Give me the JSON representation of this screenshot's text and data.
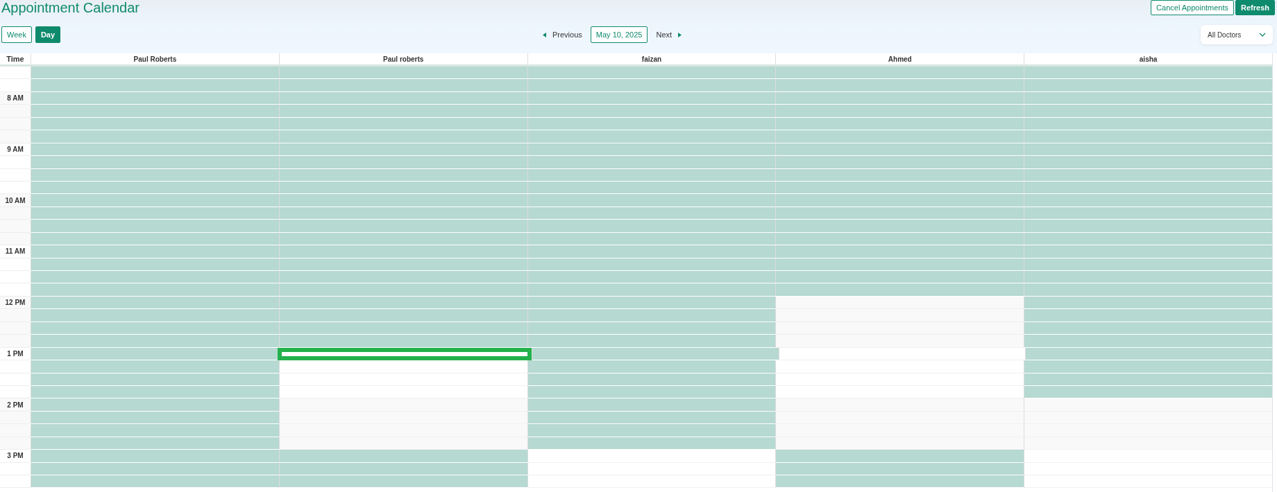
{
  "title": "Appointment Calendar",
  "actions": [
    {
      "label": "Cancel Appointments",
      "kind": "outline"
    },
    {
      "label": "Refresh",
      "kind": "solid"
    }
  ],
  "views": [
    {
      "label": "Week",
      "selected": false
    },
    {
      "label": "Day",
      "selected": true
    }
  ],
  "nav": {
    "previous": "Previous",
    "date": "May 10, 2025",
    "next": "Next"
  },
  "doctor_filter": {
    "value": "All Doctors"
  },
  "time_header": "Time",
  "doctors": [
    "Paul Roberts",
    "Paul roberts",
    "faizan",
    "Ahmed",
    "aisha"
  ],
  "rows": [
    {
      "time": "",
      "cells": [
        {
          "booked": true,
          "selected": false
        },
        {
          "booked": true,
          "selected": false
        },
        {
          "booked": true,
          "selected": false
        },
        {
          "booked": true,
          "selected": false
        },
        {
          "booked": true,
          "selected": false
        }
      ]
    },
    {
      "time": "",
      "cells": [
        {
          "booked": true,
          "selected": false
        },
        {
          "booked": true,
          "selected": false
        },
        {
          "booked": true,
          "selected": false
        },
        {
          "booked": true,
          "selected": false
        },
        {
          "booked": true,
          "selected": false
        }
      ]
    },
    {
      "time": "8 AM",
      "cells": [
        {
          "booked": true,
          "selected": false
        },
        {
          "booked": true,
          "selected": false
        },
        {
          "booked": true,
          "selected": false
        },
        {
          "booked": true,
          "selected": false
        },
        {
          "booked": true,
          "selected": false
        }
      ]
    },
    {
      "time": "",
      "cells": [
        {
          "booked": true,
          "selected": false
        },
        {
          "booked": true,
          "selected": false
        },
        {
          "booked": true,
          "selected": false
        },
        {
          "booked": true,
          "selected": false
        },
        {
          "booked": true,
          "selected": false
        }
      ]
    },
    {
      "time": "",
      "cells": [
        {
          "booked": true,
          "selected": false
        },
        {
          "booked": true,
          "selected": false
        },
        {
          "booked": true,
          "selected": false
        },
        {
          "booked": true,
          "selected": false
        },
        {
          "booked": true,
          "selected": false
        }
      ]
    },
    {
      "time": "",
      "cells": [
        {
          "booked": true,
          "selected": false
        },
        {
          "booked": true,
          "selected": false
        },
        {
          "booked": true,
          "selected": false
        },
        {
          "booked": true,
          "selected": false
        },
        {
          "booked": true,
          "selected": false
        }
      ]
    },
    {
      "time": "9 AM",
      "cells": [
        {
          "booked": true,
          "selected": false
        },
        {
          "booked": true,
          "selected": false
        },
        {
          "booked": true,
          "selected": false
        },
        {
          "booked": true,
          "selected": false
        },
        {
          "booked": true,
          "selected": false
        }
      ]
    },
    {
      "time": "",
      "cells": [
        {
          "booked": true,
          "selected": false
        },
        {
          "booked": true,
          "selected": false
        },
        {
          "booked": true,
          "selected": false
        },
        {
          "booked": true,
          "selected": false
        },
        {
          "booked": true,
          "selected": false
        }
      ]
    },
    {
      "time": "",
      "cells": [
        {
          "booked": true,
          "selected": false
        },
        {
          "booked": true,
          "selected": false
        },
        {
          "booked": true,
          "selected": false
        },
        {
          "booked": true,
          "selected": false
        },
        {
          "booked": true,
          "selected": false
        }
      ]
    },
    {
      "time": "",
      "cells": [
        {
          "booked": true,
          "selected": false
        },
        {
          "booked": true,
          "selected": false
        },
        {
          "booked": true,
          "selected": false
        },
        {
          "booked": true,
          "selected": false
        },
        {
          "booked": true,
          "selected": false
        }
      ]
    },
    {
      "time": "10 AM",
      "cells": [
        {
          "booked": true,
          "selected": false
        },
        {
          "booked": true,
          "selected": false
        },
        {
          "booked": true,
          "selected": false
        },
        {
          "booked": true,
          "selected": false
        },
        {
          "booked": true,
          "selected": false
        }
      ]
    },
    {
      "time": "",
      "cells": [
        {
          "booked": true,
          "selected": false
        },
        {
          "booked": true,
          "selected": false
        },
        {
          "booked": true,
          "selected": false
        },
        {
          "booked": true,
          "selected": false
        },
        {
          "booked": true,
          "selected": false
        }
      ]
    },
    {
      "time": "",
      "cells": [
        {
          "booked": true,
          "selected": false
        },
        {
          "booked": true,
          "selected": false
        },
        {
          "booked": true,
          "selected": false
        },
        {
          "booked": true,
          "selected": false
        },
        {
          "booked": true,
          "selected": false
        }
      ]
    },
    {
      "time": "",
      "cells": [
        {
          "booked": true,
          "selected": false
        },
        {
          "booked": true,
          "selected": false
        },
        {
          "booked": true,
          "selected": false
        },
        {
          "booked": true,
          "selected": false
        },
        {
          "booked": true,
          "selected": false
        }
      ]
    },
    {
      "time": "11 AM",
      "cells": [
        {
          "booked": true,
          "selected": false
        },
        {
          "booked": true,
          "selected": false
        },
        {
          "booked": true,
          "selected": false
        },
        {
          "booked": true,
          "selected": false
        },
        {
          "booked": true,
          "selected": false
        }
      ]
    },
    {
      "time": "",
      "cells": [
        {
          "booked": true,
          "selected": false
        },
        {
          "booked": true,
          "selected": false
        },
        {
          "booked": true,
          "selected": false
        },
        {
          "booked": true,
          "selected": false
        },
        {
          "booked": true,
          "selected": false
        }
      ]
    },
    {
      "time": "",
      "cells": [
        {
          "booked": true,
          "selected": false
        },
        {
          "booked": true,
          "selected": false
        },
        {
          "booked": true,
          "selected": false
        },
        {
          "booked": true,
          "selected": false
        },
        {
          "booked": true,
          "selected": false
        }
      ]
    },
    {
      "time": "",
      "cells": [
        {
          "booked": true,
          "selected": false
        },
        {
          "booked": true,
          "selected": false
        },
        {
          "booked": true,
          "selected": false
        },
        {
          "booked": true,
          "selected": false
        },
        {
          "booked": true,
          "selected": false
        }
      ]
    },
    {
      "time": "12 PM",
      "cells": [
        {
          "booked": true,
          "selected": false
        },
        {
          "booked": true,
          "selected": false
        },
        {
          "booked": true,
          "selected": false
        },
        {
          "booked": false,
          "selected": false
        },
        {
          "booked": true,
          "selected": false
        }
      ]
    },
    {
      "time": "",
      "cells": [
        {
          "booked": true,
          "selected": false
        },
        {
          "booked": true,
          "selected": false
        },
        {
          "booked": true,
          "selected": false
        },
        {
          "booked": false,
          "selected": false
        },
        {
          "booked": true,
          "selected": false
        }
      ]
    },
    {
      "time": "",
      "cells": [
        {
          "booked": true,
          "selected": false
        },
        {
          "booked": true,
          "selected": false
        },
        {
          "booked": true,
          "selected": false
        },
        {
          "booked": false,
          "selected": false
        },
        {
          "booked": true,
          "selected": false
        }
      ]
    },
    {
      "time": "",
      "cells": [
        {
          "booked": true,
          "selected": false
        },
        {
          "booked": true,
          "selected": false
        },
        {
          "booked": true,
          "selected": false
        },
        {
          "booked": false,
          "selected": false
        },
        {
          "booked": true,
          "selected": false
        }
      ]
    },
    {
      "time": "1 PM",
      "cells": [
        {
          "booked": true,
          "selected": false
        },
        {
          "booked": false,
          "selected": true
        },
        {
          "booked": true,
          "selected": false
        },
        {
          "booked": false,
          "selected": false
        },
        {
          "booked": true,
          "selected": false
        }
      ]
    },
    {
      "time": "",
      "cells": [
        {
          "booked": true,
          "selected": false
        },
        {
          "booked": false,
          "selected": false
        },
        {
          "booked": true,
          "selected": false
        },
        {
          "booked": false,
          "selected": false
        },
        {
          "booked": true,
          "selected": false
        }
      ]
    },
    {
      "time": "",
      "cells": [
        {
          "booked": true,
          "selected": false
        },
        {
          "booked": false,
          "selected": false
        },
        {
          "booked": true,
          "selected": false
        },
        {
          "booked": false,
          "selected": false
        },
        {
          "booked": true,
          "selected": false
        }
      ]
    },
    {
      "time": "",
      "cells": [
        {
          "booked": true,
          "selected": false
        },
        {
          "booked": false,
          "selected": false
        },
        {
          "booked": true,
          "selected": false
        },
        {
          "booked": false,
          "selected": false
        },
        {
          "booked": true,
          "selected": false
        }
      ]
    },
    {
      "time": "2 PM",
      "cells": [
        {
          "booked": true,
          "selected": false
        },
        {
          "booked": false,
          "selected": false
        },
        {
          "booked": true,
          "selected": false
        },
        {
          "booked": false,
          "selected": false
        },
        {
          "booked": false,
          "selected": false
        }
      ]
    },
    {
      "time": "",
      "cells": [
        {
          "booked": true,
          "selected": false
        },
        {
          "booked": false,
          "selected": false
        },
        {
          "booked": true,
          "selected": false
        },
        {
          "booked": false,
          "selected": false
        },
        {
          "booked": false,
          "selected": false
        }
      ]
    },
    {
      "time": "",
      "cells": [
        {
          "booked": true,
          "selected": false
        },
        {
          "booked": false,
          "selected": false
        },
        {
          "booked": true,
          "selected": false
        },
        {
          "booked": false,
          "selected": false
        },
        {
          "booked": false,
          "selected": false
        }
      ]
    },
    {
      "time": "",
      "cells": [
        {
          "booked": true,
          "selected": false
        },
        {
          "booked": false,
          "selected": false
        },
        {
          "booked": true,
          "selected": false
        },
        {
          "booked": false,
          "selected": false
        },
        {
          "booked": false,
          "selected": false
        }
      ]
    },
    {
      "time": "3 PM",
      "cells": [
        {
          "booked": true,
          "selected": false
        },
        {
          "booked": true,
          "selected": false
        },
        {
          "booked": false,
          "selected": false
        },
        {
          "booked": true,
          "selected": false
        },
        {
          "booked": false,
          "selected": false
        }
      ]
    },
    {
      "time": "",
      "cells": [
        {
          "booked": true,
          "selected": false
        },
        {
          "booked": true,
          "selected": false
        },
        {
          "booked": false,
          "selected": false
        },
        {
          "booked": true,
          "selected": false
        },
        {
          "booked": false,
          "selected": false
        }
      ]
    },
    {
      "time": "",
      "cells": [
        {
          "booked": true,
          "selected": false
        },
        {
          "booked": true,
          "selected": false
        },
        {
          "booked": false,
          "selected": false
        },
        {
          "booked": true,
          "selected": false
        },
        {
          "booked": false,
          "selected": false
        }
      ]
    }
  ]
}
